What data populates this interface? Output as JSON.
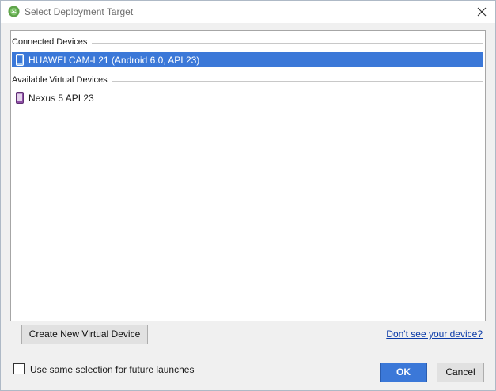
{
  "window": {
    "title": "Select Deployment Target",
    "app_icon": "android-studio-icon",
    "close_icon": "close-icon"
  },
  "groups": [
    {
      "label": "Connected Devices",
      "devices": [
        {
          "label": "HUAWEI CAM-L21 (Android 6.0, API 23)",
          "icon": "phone-icon",
          "selected": true
        }
      ]
    },
    {
      "label": "Available Virtual Devices",
      "devices": [
        {
          "label": "Nexus 5 API 23",
          "icon": "virtual-device-icon",
          "selected": false
        }
      ]
    }
  ],
  "actions": {
    "create_label": "Create New Virtual Device",
    "help_link": "Don't see your device?",
    "remember_label": "Use same selection for future launches",
    "remember_checked": false,
    "ok_label": "OK",
    "cancel_label": "Cancel"
  },
  "colors": {
    "selection": "#3b78d8",
    "link": "#0b3ba8"
  }
}
